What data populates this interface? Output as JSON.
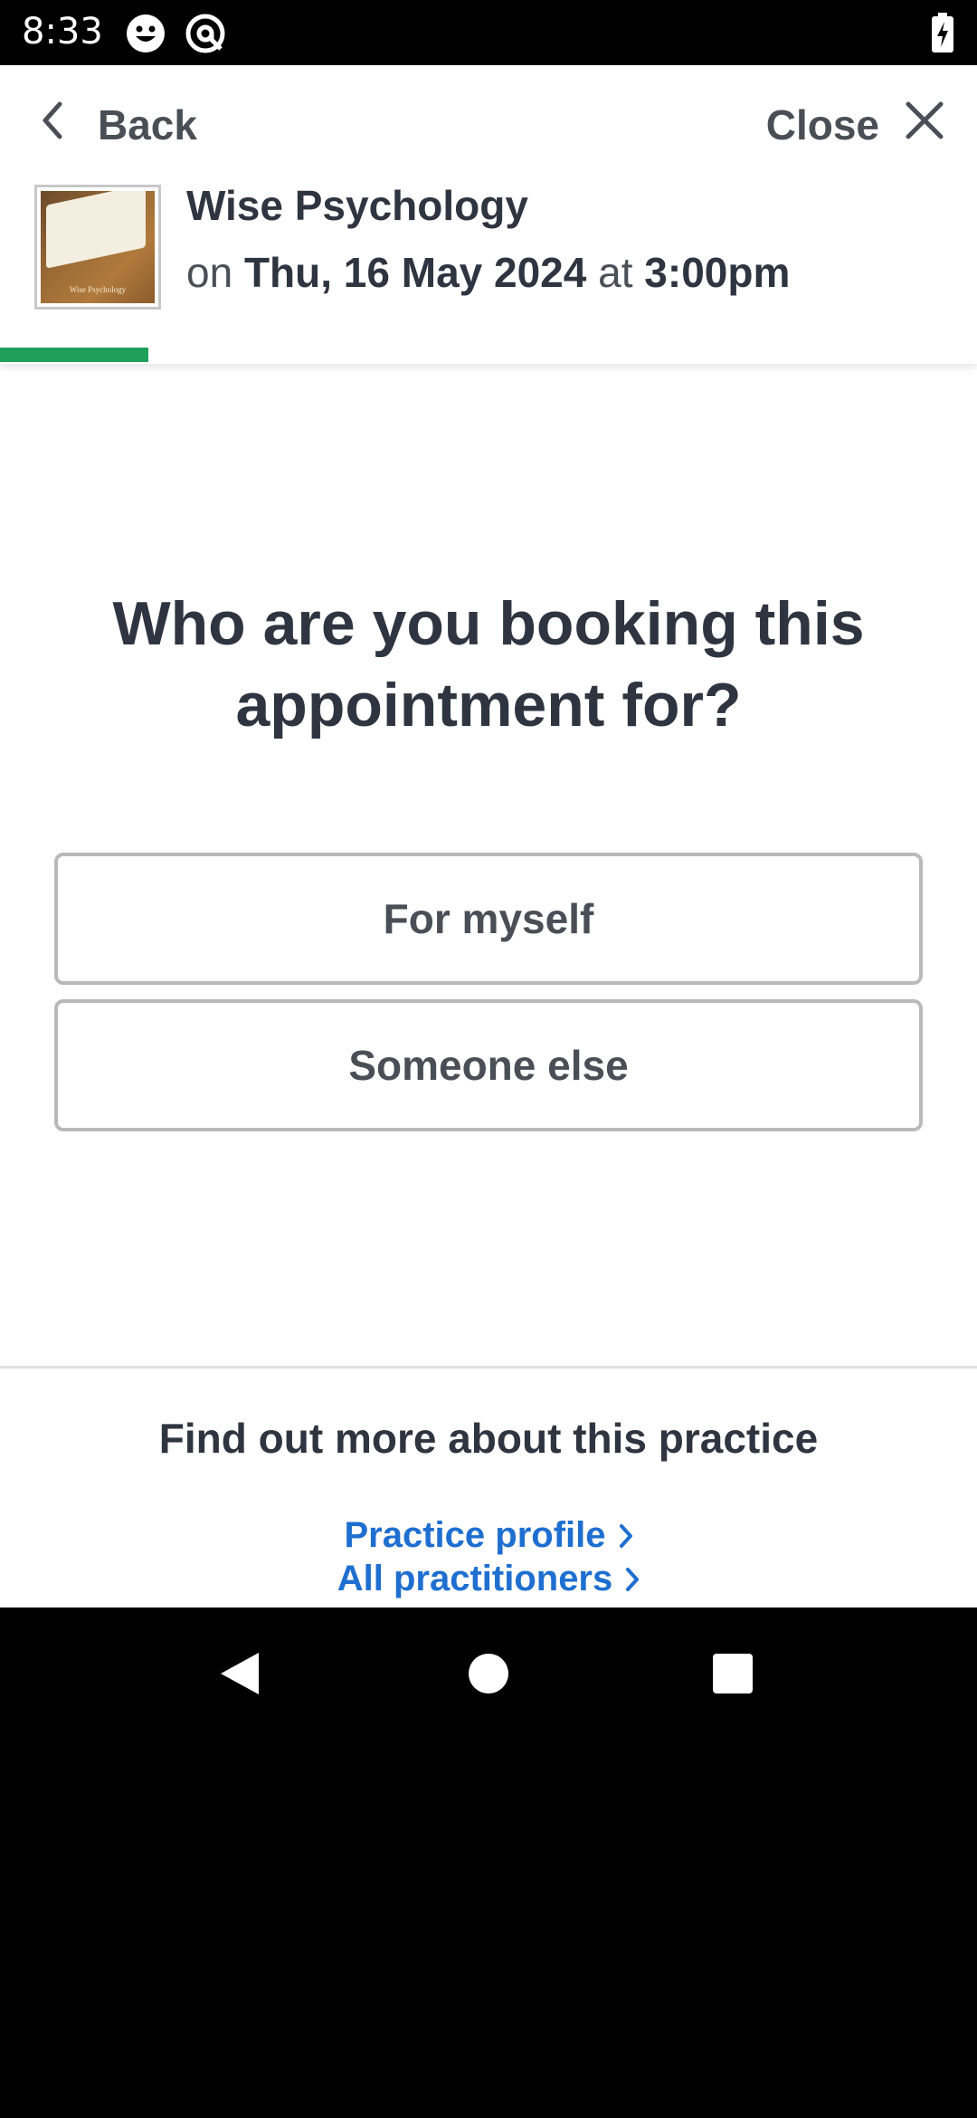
{
  "status_bar": {
    "time": "8:33",
    "icons": [
      "smiley-icon",
      "at-sign-icon",
      "battery-charging-icon"
    ]
  },
  "header": {
    "back_label": "Back",
    "close_label": "Close",
    "practice_name": "Wise Psychology",
    "appointment": {
      "prefix": "on",
      "date": "Thu, 16 May 2024",
      "connector": "at",
      "time": "3:00pm"
    },
    "thumbnail_logo_text": "Wise Psychology",
    "progress_fraction": 0.152
  },
  "main": {
    "question": "Who are you booking this appointment for?",
    "options": [
      {
        "label": "For myself"
      },
      {
        "label": "Someone else"
      }
    ]
  },
  "footer": {
    "heading": "Find out more about this practice",
    "links": [
      {
        "label": "Practice profile"
      },
      {
        "label": "All practitioners"
      }
    ]
  },
  "colors": {
    "accent_green": "#1ea05a",
    "link_blue": "#1e6fd0",
    "text_dark": "#2f3540"
  }
}
